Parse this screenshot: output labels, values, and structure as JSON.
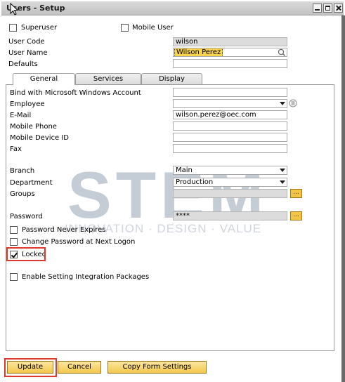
{
  "window": {
    "title": "Users - Setup"
  },
  "header": {
    "superuser_label": "Superuser",
    "superuser_checked": false,
    "mobile_user_label": "Mobile User",
    "mobile_user_checked": false,
    "user_code_label": "User Code",
    "user_code_value": "wilson",
    "user_name_label": "User Name",
    "user_name_value": "Wilson Perez",
    "defaults_label": "Defaults",
    "defaults_value": ""
  },
  "tabs": [
    {
      "label": "General",
      "active": true
    },
    {
      "label": "Services",
      "active": false
    },
    {
      "label": "Display",
      "active": false
    }
  ],
  "general": {
    "bind_label": "Bind with Microsoft Windows Account",
    "bind_value": "",
    "employee_label": "Employee",
    "employee_value": "",
    "email_label": "E-Mail",
    "email_value": "wilson.perez@oec.com",
    "mobile_phone_label": "Mobile Phone",
    "mobile_phone_value": "",
    "mobile_device_label": "Mobile Device ID",
    "mobile_device_value": "",
    "fax_label": "Fax",
    "fax_value": "",
    "branch_label": "Branch",
    "branch_value": "Main",
    "department_label": "Department",
    "department_value": "Production",
    "groups_label": "Groups",
    "groups_value": "",
    "password_label": "Password",
    "password_value": "****",
    "pw_never_expires_label": "Password Never Expires",
    "pw_never_expires_checked": false,
    "change_pw_label": "Change Password at Next Logon",
    "change_pw_checked": false,
    "locked_label": "Locked",
    "locked_checked": true,
    "enable_integration_label": "Enable Setting Integration Packages",
    "enable_integration_checked": false
  },
  "watermark": {
    "brand": "STEM",
    "tagline": "INNOVATION · DESIGN · VALUE"
  },
  "buttons": {
    "update": "Update",
    "cancel": "Cancel",
    "copy_form_settings": "Copy Form Settings"
  },
  "colors": {
    "button_fill": "#f3c74b",
    "highlight_frame": "#e0392b",
    "selected_text_bg": "#f7d24b"
  }
}
